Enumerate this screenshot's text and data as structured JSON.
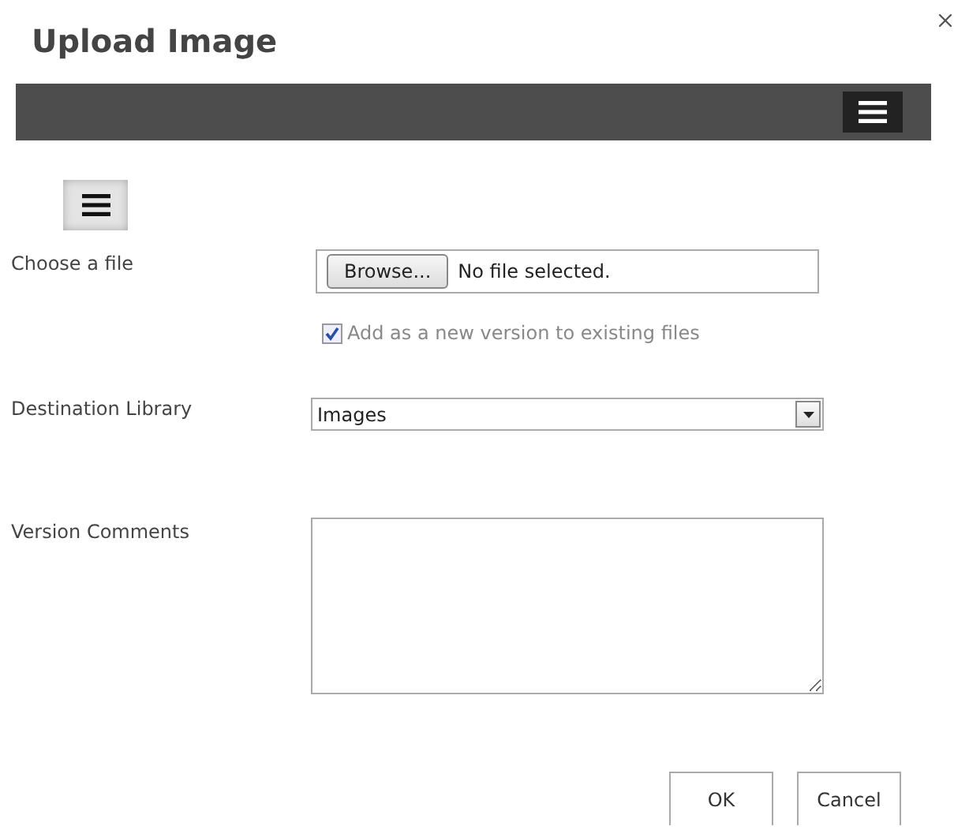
{
  "window": {
    "title": "Upload Image"
  },
  "file": {
    "label": "Choose a file",
    "button": "Browse...",
    "status": "No file selected."
  },
  "version_checkbox": {
    "label": "Add as a new version to existing files",
    "checked": true,
    "disabled": true
  },
  "destination": {
    "label": "Destination Library",
    "value": "Images"
  },
  "comments": {
    "label": "Version Comments"
  },
  "buttons": [
    "OK",
    "Cancel"
  ]
}
